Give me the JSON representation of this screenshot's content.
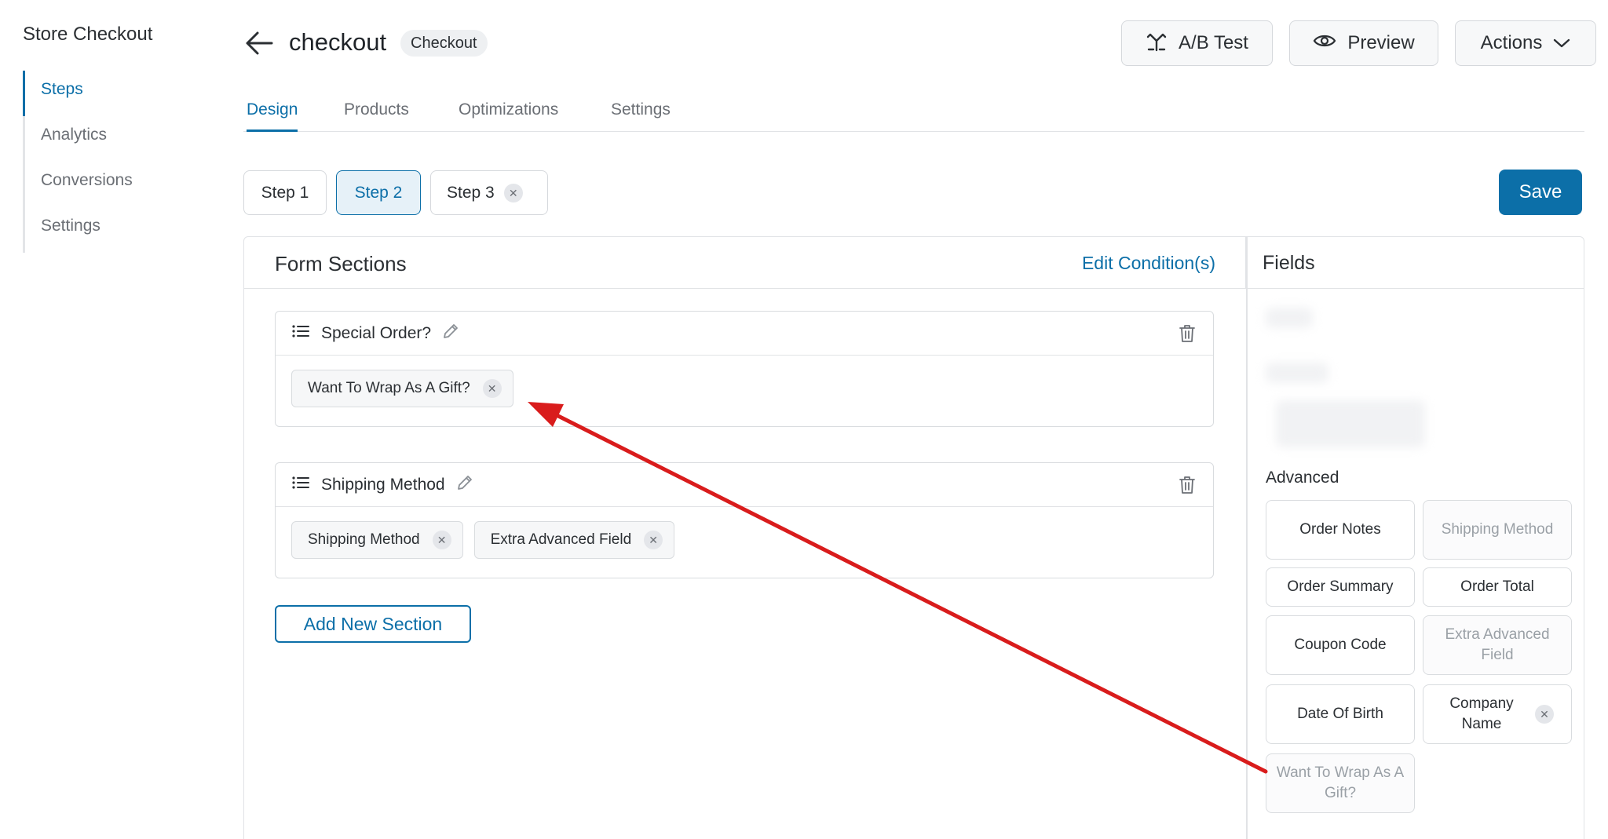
{
  "sidebar": {
    "title": "Store Checkout",
    "items": [
      {
        "label": "Steps",
        "active": true
      },
      {
        "label": "Analytics",
        "active": false
      },
      {
        "label": "Conversions",
        "active": false
      },
      {
        "label": "Settings",
        "active": false
      }
    ]
  },
  "header": {
    "title": "checkout",
    "badge": "Checkout",
    "back_icon": "arrow-left-icon",
    "ab_test_label": "A/B Test",
    "preview_label": "Preview",
    "actions_label": "Actions"
  },
  "tabs": [
    {
      "label": "Design",
      "active": true
    },
    {
      "label": "Products",
      "active": false
    },
    {
      "label": "Optimizations",
      "active": false
    },
    {
      "label": "Settings",
      "active": false
    }
  ],
  "steps": [
    {
      "label": "Step 1",
      "active": false
    },
    {
      "label": "Step 2",
      "active": true
    },
    {
      "label": "Step 3",
      "active": false
    }
  ],
  "save_label": "Save",
  "form_sections": {
    "title": "Form Sections",
    "edit_conditions_label": "Edit Condition(s)",
    "sections": [
      {
        "name": "Special Order?",
        "fields": [
          "Want To Wrap As A Gift?"
        ]
      },
      {
        "name": "Shipping Method",
        "fields": [
          "Shipping Method",
          "Extra Advanced Field"
        ]
      }
    ],
    "add_section_label": "Add New Section"
  },
  "fields_panel": {
    "title": "Fields",
    "advanced_label": "Advanced",
    "advanced_fields": [
      {
        "label": "Order Notes",
        "disabled": false
      },
      {
        "label": "Shipping Method",
        "disabled": true
      },
      {
        "label": "Order Summary",
        "disabled": false
      },
      {
        "label": "Order Total",
        "disabled": false
      },
      {
        "label": "Coupon Code",
        "disabled": false
      },
      {
        "label": "Extra Advanced Field",
        "disabled": true
      },
      {
        "label": "Date Of Birth",
        "disabled": false
      },
      {
        "label": "Company Name",
        "disabled": false
      },
      {
        "label": "Want To Wrap As A Gift?",
        "disabled": true
      }
    ]
  },
  "colors": {
    "accent": "#0c6fa8",
    "annotation_arrow": "#d91c1c"
  }
}
